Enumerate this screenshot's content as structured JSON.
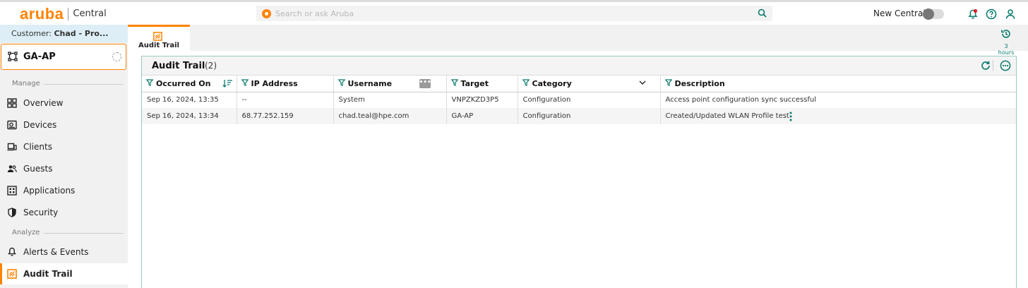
{
  "header": {
    "logo_text": "aruba",
    "product": "Central",
    "search_placeholder": "Search or ask Aruba",
    "new_central_label": "New Central",
    "new_central_enabled": false
  },
  "sidebar": {
    "customer_prefix": "Customer:",
    "customer_name": "Chad - Pro...",
    "device_name": "GA-AP",
    "sections": {
      "manage": "Manage",
      "analyze": "Analyze"
    },
    "items": [
      {
        "label": "Overview",
        "icon": "grid-icon"
      },
      {
        "label": "Devices",
        "icon": "device-icon"
      },
      {
        "label": "Clients",
        "icon": "laptop-icon"
      },
      {
        "label": "Guests",
        "icon": "users-icon"
      },
      {
        "label": "Applications",
        "icon": "apps-icon"
      },
      {
        "label": "Security",
        "icon": "shield-icon"
      },
      {
        "label": "Alerts & Events",
        "icon": "bell-icon"
      },
      {
        "label": "Audit Trail",
        "icon": "audit-icon",
        "active": true
      }
    ]
  },
  "tabbar": {
    "active_tab": "Audit Trail",
    "time_range": "3 hours"
  },
  "panel": {
    "title": "Audit Trail",
    "count": "(2)"
  },
  "table": {
    "columns": [
      "Occurred On",
      "IP Address",
      "Username",
      "Target",
      "Category",
      "Description"
    ],
    "rows": [
      [
        "Sep 16, 2024, 13:35",
        "--",
        "System",
        "VNPZKZD3P5",
        "Configuration",
        "Access point configuration sync successful"
      ],
      [
        "Sep 16, 2024, 13:34",
        "68.77.252.159",
        "chad.teal@hpe.com",
        "GA-AP",
        "Configuration",
        "Created/Updated WLAN Profile test"
      ]
    ]
  },
  "colors": {
    "brand": "#ff8300",
    "accent": "#0a7b6c",
    "notification": "#e0202f"
  }
}
